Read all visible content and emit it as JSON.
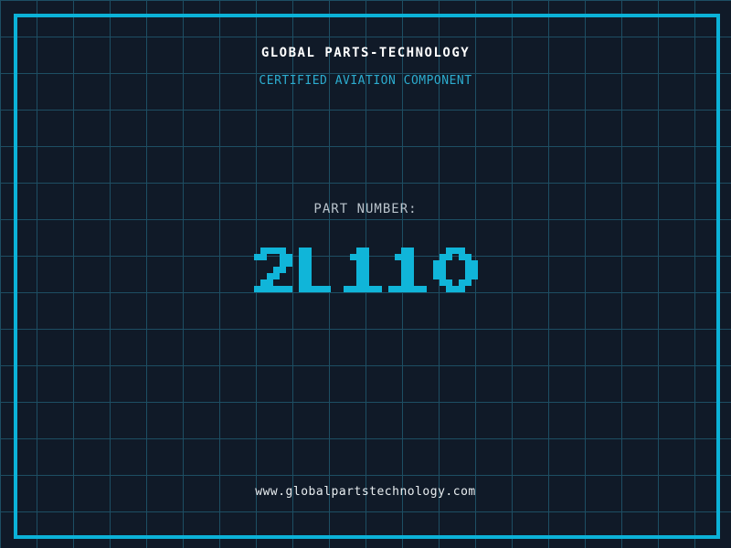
{
  "page": {
    "background_color": "#101a28",
    "grid_color": "#1d4e63",
    "frame_color": "#0bb2d8",
    "grid_spacing_px": 40
  },
  "header": {
    "title": "GLOBAL PARTS-TECHNOLOGY",
    "title_color": "#ffffff",
    "subtitle": "CERTIFIED AVIATION COMPONENT",
    "subtitle_color": "#2caccf"
  },
  "part": {
    "label": "PART NUMBER:",
    "label_color": "#b9c3cb",
    "value": "2L110",
    "value_color": "#10b5d9"
  },
  "footer": {
    "website": "www.globalpartstechnology.com",
    "color": "#e8edf0"
  }
}
